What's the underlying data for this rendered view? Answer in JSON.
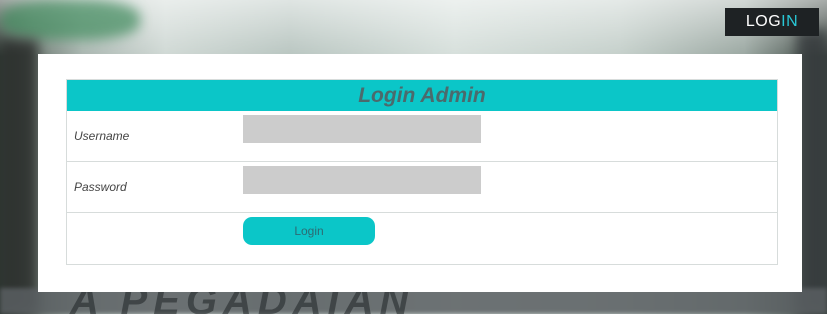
{
  "header": {
    "login_button_prefix": "LOG",
    "login_button_accent": "IN"
  },
  "background": {
    "watermark_text": "A PEGADAIAN"
  },
  "form": {
    "title": "Login Admin",
    "username_label": "Username",
    "username_value": "",
    "password_label": "Password",
    "password_value": "",
    "submit_label": "Login"
  },
  "colors": {
    "accent": "#0bc6c8",
    "top_button_bg": "#1e2224",
    "field_bg": "#cccccc"
  }
}
